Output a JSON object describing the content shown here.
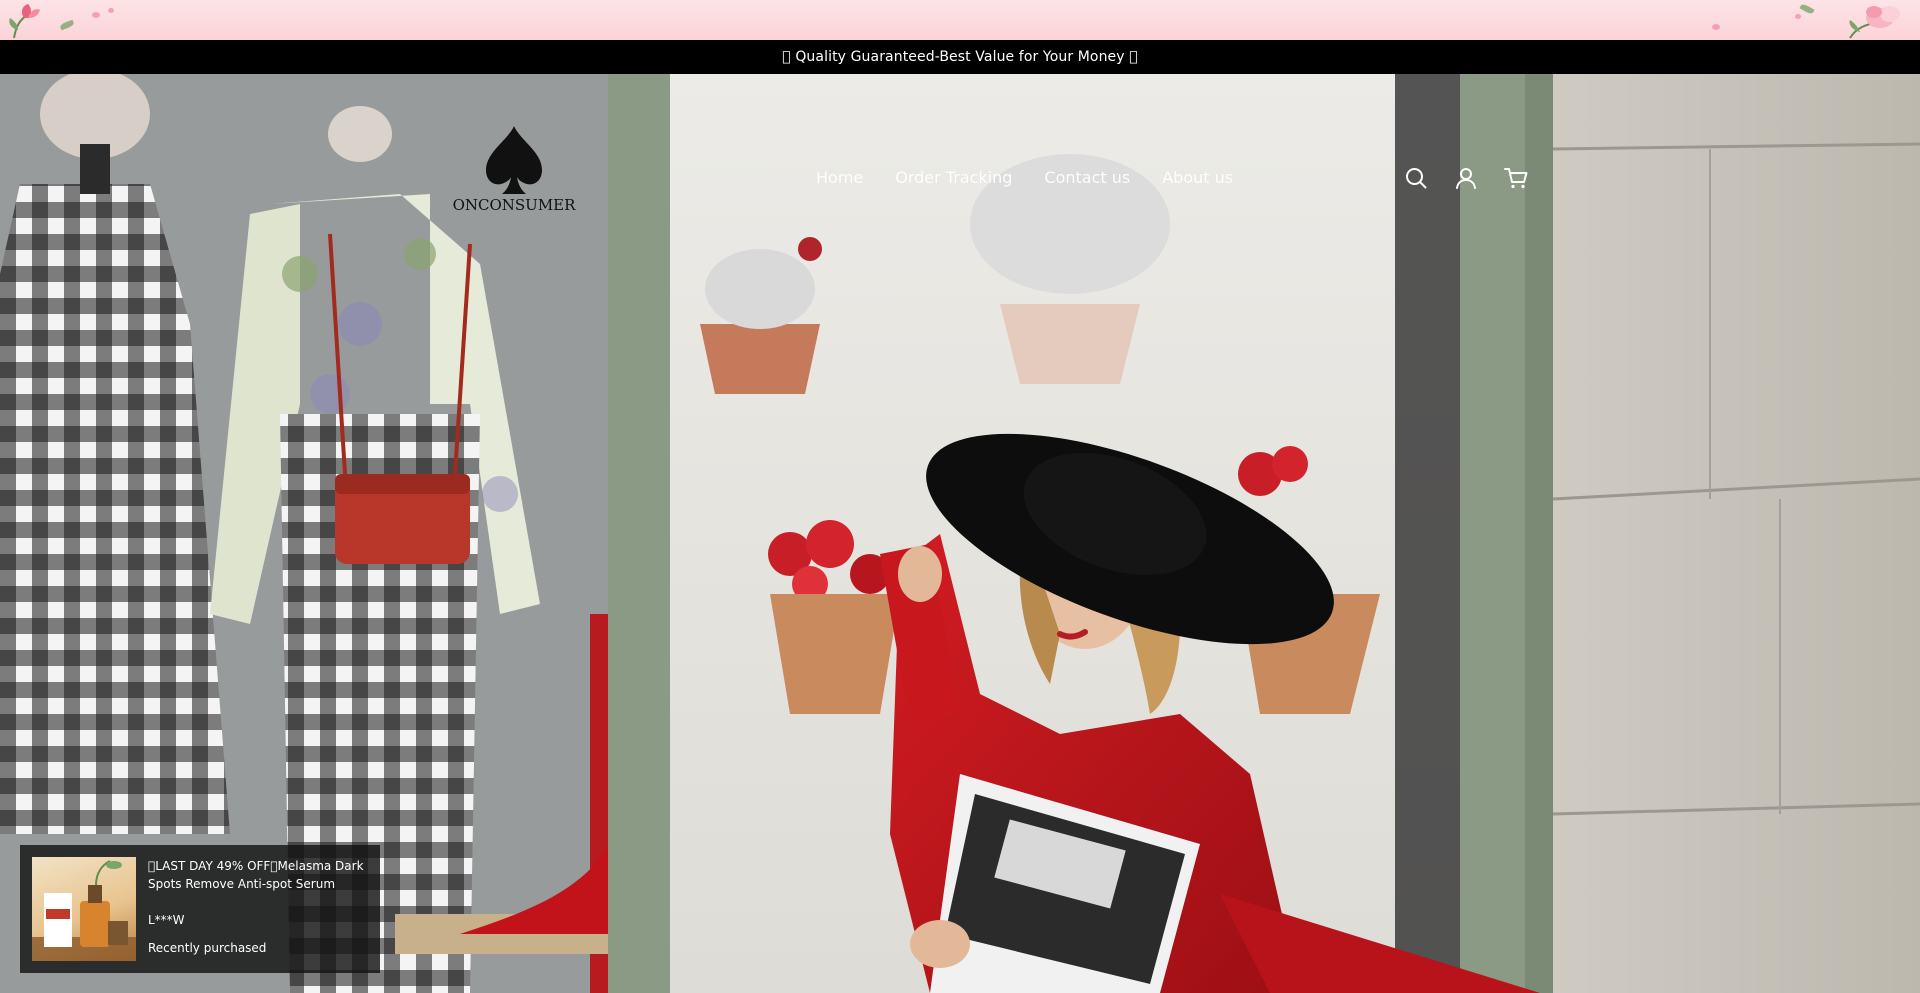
{
  "announcement": {
    "text": " Quality Guaranteed-Best Value for Your Money "
  },
  "header": {
    "logo_text": "ONCONSUMER",
    "nav": [
      {
        "label": "Home"
      },
      {
        "label": "Order Tracking"
      },
      {
        "label": "Contact us"
      },
      {
        "label": "About us"
      }
    ],
    "icons": [
      "search-icon",
      "account-icon",
      "cart-icon"
    ]
  },
  "colors": {
    "announcement_bg": "#000000",
    "strip_pink": "#fbd3d8",
    "coat_red": "#c2141b"
  },
  "popup": {
    "title": "LAST DAY 49% OFFMelasma Dark Spots Remove Anti-spot Serum",
    "user": "L***W",
    "status": "Recently purchased"
  }
}
